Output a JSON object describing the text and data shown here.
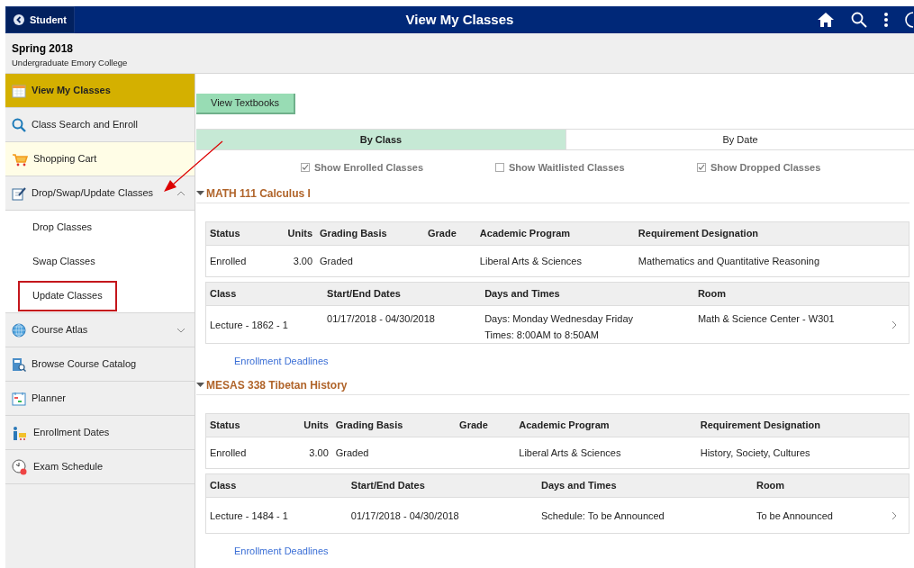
{
  "top_bar": {
    "back_button": "Student",
    "title": "View My Classes"
  },
  "term": {
    "name": "Spring 2018",
    "career": "Undergraduate Emory College"
  },
  "sidebar": {
    "items": [
      {
        "label": "View My Classes",
        "selected": true,
        "hovered": false
      },
      {
        "label": "Class Search and Enroll",
        "selected": false,
        "hovered": false
      },
      {
        "label": "Shopping Cart",
        "selected": false,
        "hovered": true
      },
      {
        "label": "Drop/Swap/Update Classes",
        "selected": false,
        "hovered": false,
        "expanded": true,
        "children": [
          {
            "label": "Drop Classes",
            "highlighted": false
          },
          {
            "label": "Swap Classes",
            "highlighted": false
          },
          {
            "label": "Update Classes",
            "highlighted": true
          }
        ]
      },
      {
        "label": "Course Atlas",
        "selected": false,
        "hovered": false,
        "expanded": false
      },
      {
        "label": "Browse Course Catalog",
        "selected": false,
        "hovered": false
      },
      {
        "label": "Planner",
        "selected": false,
        "hovered": false
      },
      {
        "label": "Enrollment Dates",
        "selected": false,
        "hovered": false
      },
      {
        "label": "Exam Schedule",
        "selected": false,
        "hovered": false
      }
    ]
  },
  "view_textbooks_button": "View Textbooks",
  "tabs": [
    {
      "label": "By Class",
      "selected": true
    },
    {
      "label": "By Date",
      "selected": false
    }
  ],
  "filters": [
    {
      "label": "Show Enrolled Classes",
      "checked": true
    },
    {
      "label": "Show Waitlisted Classes",
      "checked": false
    },
    {
      "label": "Show Dropped Classes",
      "checked": true
    }
  ],
  "courses": [
    {
      "title": "MATH 111 Calculus I",
      "enrollment_columns": [
        "Status",
        "Units",
        "Grading Basis",
        "Grade",
        "Academic Program",
        "Requirement Designation"
      ],
      "enrollment_row": {
        "status": "Enrolled",
        "units": "3.00",
        "grading_basis": "Graded",
        "academic_program": "Liberal Arts & Sciences",
        "requirement_designation": "Mathematics and Quantitative Reasoning"
      },
      "class_columns": [
        "Class",
        "Start/End Dates",
        "Days and Times",
        "Room"
      ],
      "class_row": [
        [
          "Lecture - 1862 - 1"
        ],
        [
          "01/17/2018 - 04/30/2018"
        ],
        [
          "Days: Monday Wednesday Friday",
          "Times: 8:00AM to 8:50AM"
        ],
        [
          "Math & Science Center - W301"
        ]
      ],
      "link": "Enrollment Deadlines"
    },
    {
      "title": "MESAS 338 Tibetan History",
      "enrollment_columns": [
        "Status",
        "Units",
        "Grading Basis",
        "Grade",
        "Academic Program",
        "Requirement Designation"
      ],
      "enrollment_row": {
        "status": "Enrolled",
        "units": "3.00",
        "grading_basis": "Graded",
        "academic_program": "Liberal Arts & Sciences",
        "requirement_designation": "History, Society, Cultures"
      },
      "class_columns": [
        "Class",
        "Start/End Dates",
        "Days and Times",
        "Room"
      ],
      "class_row": [
        [
          "Lecture - 1484 - 1"
        ],
        [
          "01/17/2018 - 04/30/2018"
        ],
        [
          "Schedule: To be Announced"
        ],
        [
          "To be Announced"
        ]
      ],
      "link": "Enrollment Deadlines"
    }
  ]
}
